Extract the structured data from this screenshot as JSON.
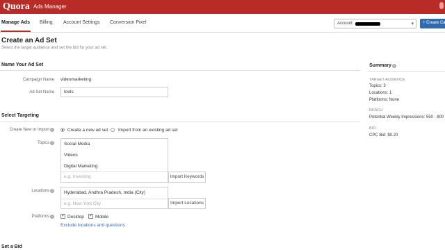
{
  "app": {
    "logo": "Quora",
    "name": "Ads Manager"
  },
  "nav": {
    "tabs": [
      {
        "label": "Manage Ads"
      },
      {
        "label": "Billing"
      },
      {
        "label": "Account Settings"
      },
      {
        "label": "Conversion Pixel"
      }
    ],
    "account_label": "Account:",
    "create_label": "+ Create Ca"
  },
  "page": {
    "title": "Create an Ad Set",
    "subtitle": "Select the target audience and set the bid for your ad set."
  },
  "name_section": {
    "heading": "Name Your Ad Set",
    "campaign_label": "Campaign Name",
    "campaign_value": "videomarketing",
    "adset_label": "Ad Set Name",
    "adset_value": "tools"
  },
  "targeting": {
    "heading": "Select Targeting",
    "create_label": "Create New or Import",
    "option_new": "Create a new ad set",
    "option_import": "Import from an existing ad set",
    "topics_label": "Topics",
    "topics": [
      "Social Media",
      "Videos",
      "Digital Marketing"
    ],
    "topics_placeholder": "e.g. Investing",
    "import_keywords": "Import Keywords",
    "locations_label": "Locations",
    "location_value": "Hyderabad, Andhra Pradesh, India (City)",
    "locations_placeholder": "e.g. New York City",
    "import_locations": "Import Locations",
    "platforms_label": "Platforms",
    "platform_desktop": "Desktop",
    "platform_mobile": "Mobile",
    "exclude_link": "Exclude locations and questions"
  },
  "bid_section": {
    "heading": "Set a Bid"
  },
  "summary": {
    "title": "Summary",
    "audience_head": "TARGET AUDIENCE",
    "topics": "Topics: 3",
    "locations": "Locations: 1",
    "platforms": "Platforms: None",
    "reach_head": "REACH",
    "reach": "Potential Weekly Impressions: 550 - 800",
    "bid_head": "BID",
    "bid": "CPC Bid: $0.20"
  }
}
